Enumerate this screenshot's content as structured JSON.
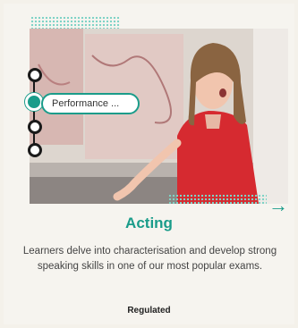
{
  "card": {
    "pill_label": "Performance ...",
    "title": "Acting",
    "description": "Learners delve into characterisation and develop strong speaking skills in one of our most popular exams.",
    "badge": "Regulated"
  },
  "colors": {
    "accent": "#1a9c8a",
    "background": "#f4f1ea",
    "text": "#444444"
  },
  "icons": {
    "next": "arrow-right-icon",
    "steps": "timeline-dots-icon"
  }
}
